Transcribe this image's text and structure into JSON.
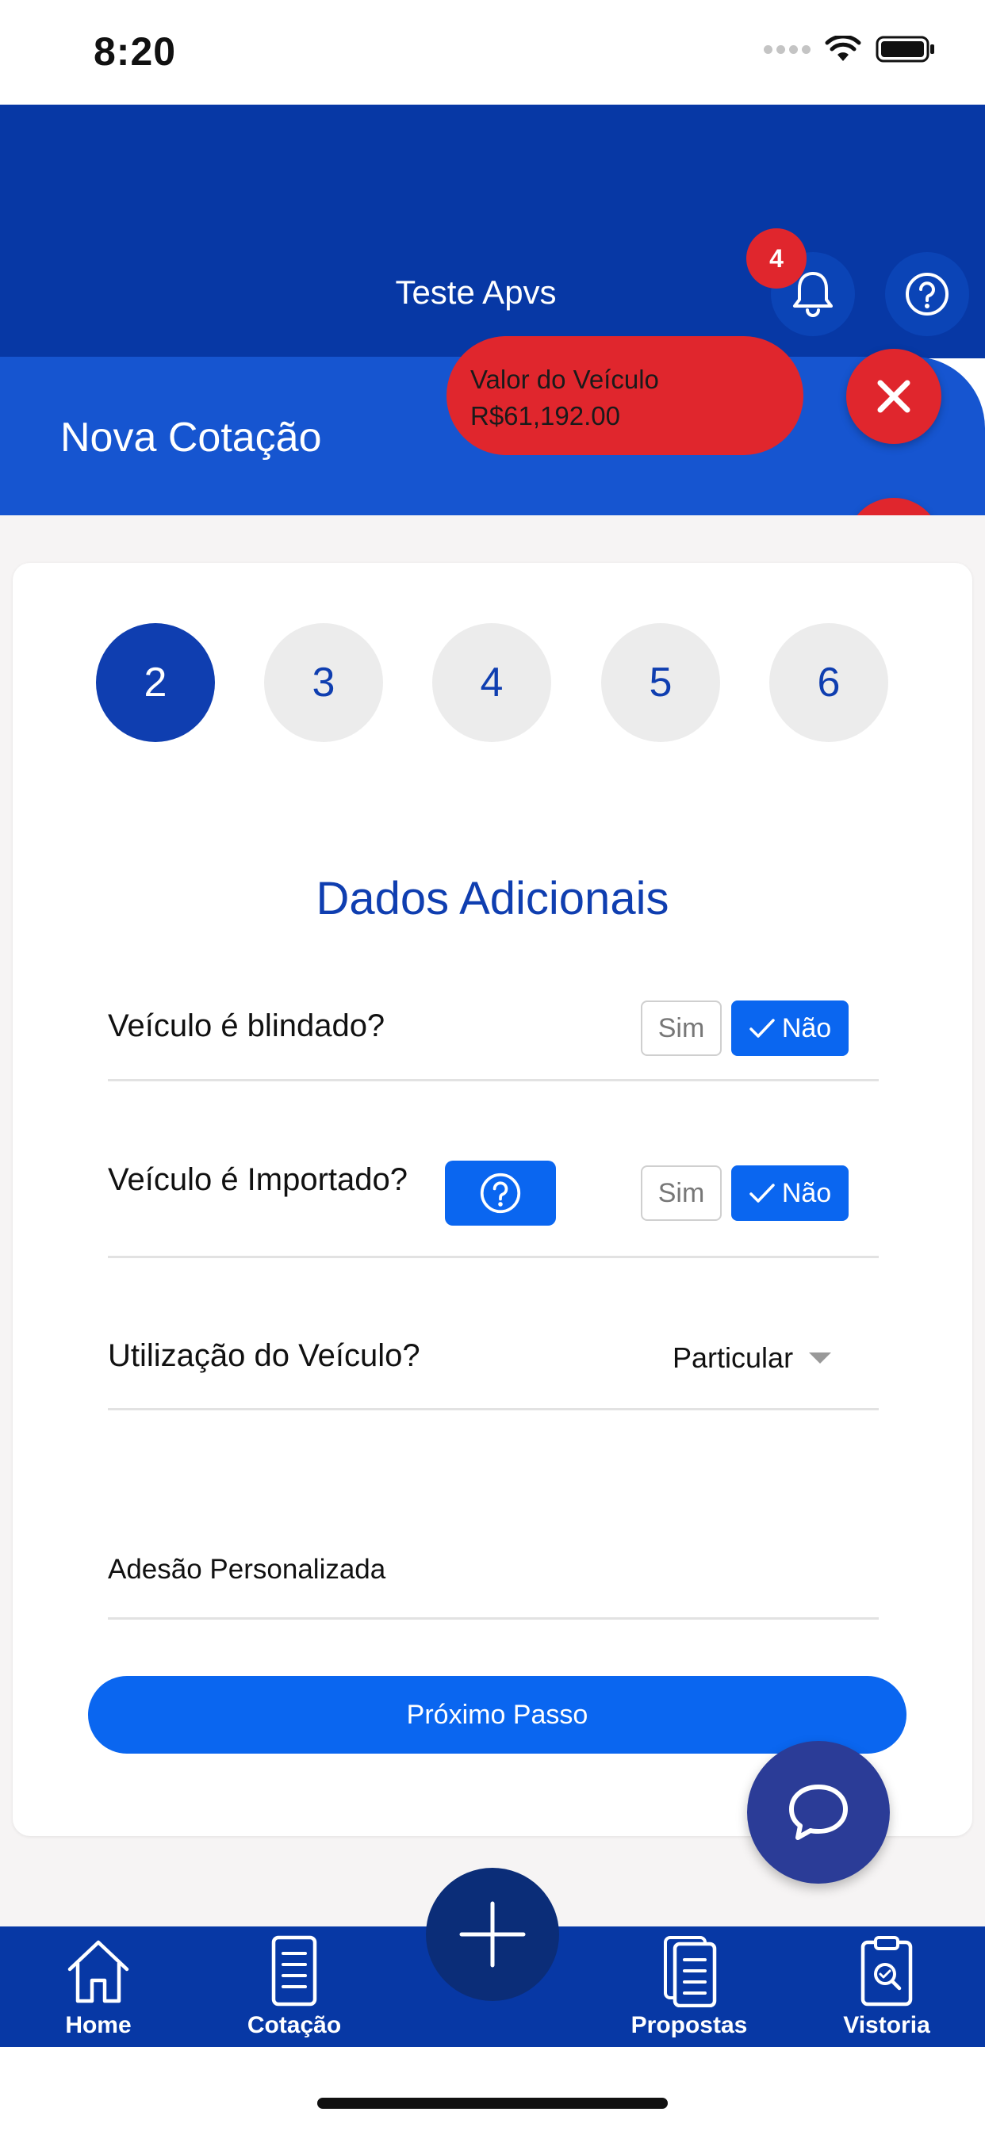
{
  "status_bar": {
    "time": "8:20"
  },
  "header": {
    "title": "Teste Apvs",
    "notification_count": "4",
    "page_title": "Nova Cotação"
  },
  "vehicle_value": {
    "label": "Valor do Veículo",
    "amount": "R$61,192.00"
  },
  "steps": [
    {
      "label": "2",
      "active": true
    },
    {
      "label": "3",
      "active": false
    },
    {
      "label": "4",
      "active": false
    },
    {
      "label": "5",
      "active": false
    },
    {
      "label": "6",
      "active": false
    }
  ],
  "form": {
    "section_title": "Dados Adicionais",
    "q_blindado": {
      "label": "Veículo é blindado?",
      "yes": "Sim",
      "no": "Não",
      "selected": "Não"
    },
    "q_importado": {
      "label": "Veículo é Importado?",
      "yes": "Sim",
      "no": "Não",
      "selected": "Não"
    },
    "q_utilizacao": {
      "label": "Utilização do Veículo?",
      "value": "Particular"
    },
    "adesao_label": "Adesão Personalizada",
    "next_button": "Próximo Passo"
  },
  "bottom_nav": {
    "items": [
      {
        "label": "Home",
        "icon": "home-icon"
      },
      {
        "label": "Cotação",
        "icon": "document-icon"
      },
      {
        "label": "Propostas",
        "icon": "documents-icon"
      },
      {
        "label": "Vistoria",
        "icon": "clipboard-search-icon"
      }
    ]
  },
  "colors": {
    "header_dark": "#0738a5",
    "header_light": "#1655d0",
    "accent_red": "#e0262d",
    "primary_blue": "#0a66f0",
    "step_blue": "#0f3eb0"
  }
}
